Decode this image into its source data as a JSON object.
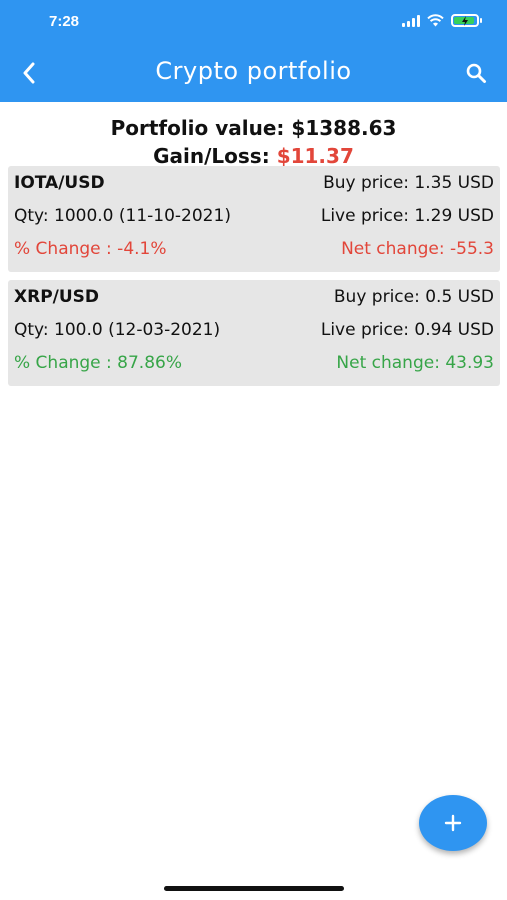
{
  "status_bar": {
    "time": "7:28"
  },
  "app_bar": {
    "title": "Crypto portfolio"
  },
  "summary": {
    "portfolio_label": "Portfolio value:",
    "portfolio_value": "$1388.63",
    "gain_label": "Gain/Loss:",
    "gain_value": "$11.37"
  },
  "colors": {
    "accent": "#2f95f1",
    "negative": "#e2463a",
    "positive": "#37a548",
    "card_bg": "#e6e6e6"
  },
  "holdings": [
    {
      "pair": "IOTA/USD",
      "buy_price": "Buy price: 1.35 USD",
      "qty": "Qty: 1000.0 (11-10-2021)",
      "live_price": "Live price: 1.29 USD",
      "pct_change": "% Change : -4.1%",
      "net_change": "Net change: -55.3"
    },
    {
      "pair": "XRP/USD",
      "buy_price": "Buy price: 0.5 USD",
      "qty": "Qty: 100.0 (12-03-2021)",
      "live_price": "Live price: 0.94 USD",
      "pct_change": "% Change : 87.86%",
      "net_change": "Net change: 43.93"
    }
  ],
  "icons": {
    "back": "back-arrow-icon",
    "search": "search-icon",
    "add": "plus-icon"
  }
}
